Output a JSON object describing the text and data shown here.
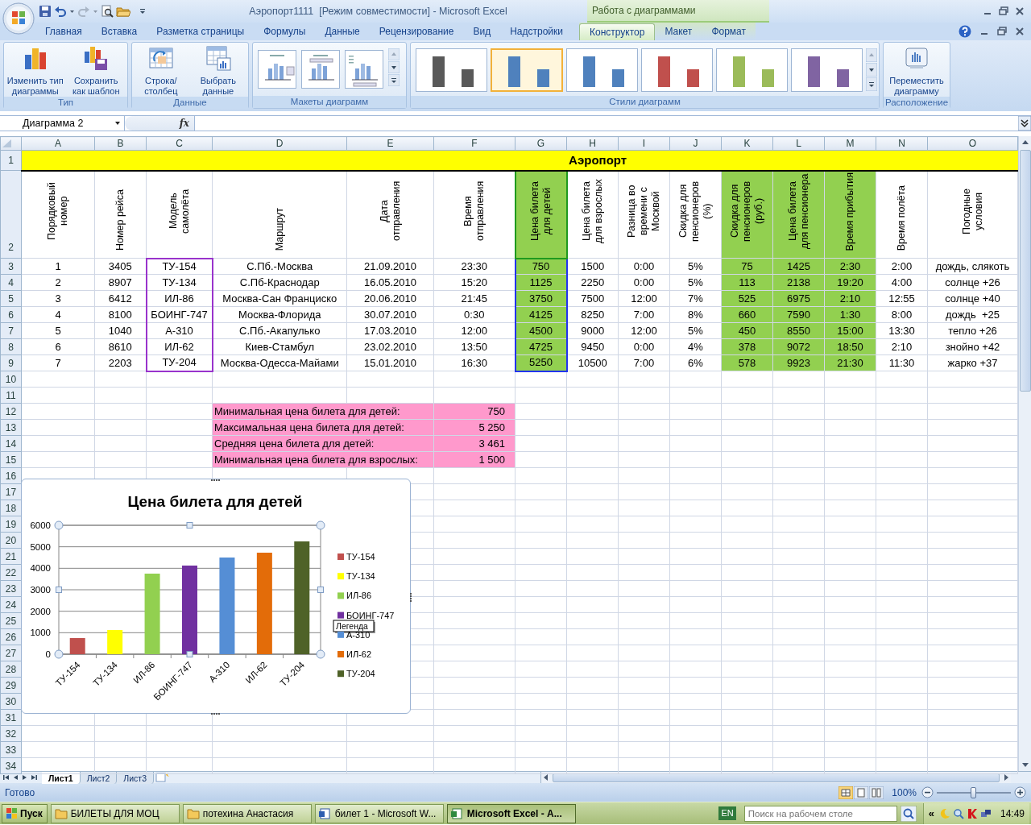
{
  "title_bar": {
    "title": "Аэропорт1111  [Режим совместимости] - Microsoft Excel",
    "context_group": "Работа с диаграммами"
  },
  "ribbon_tabs": [
    {
      "label": "Главная",
      "selected": false,
      "contextual": false
    },
    {
      "label": "Вставка",
      "selected": false,
      "contextual": false
    },
    {
      "label": "Разметка страницы",
      "selected": false,
      "contextual": false
    },
    {
      "label": "Формулы",
      "selected": false,
      "contextual": false
    },
    {
      "label": "Данные",
      "selected": false,
      "contextual": false
    },
    {
      "label": "Рецензирование",
      "selected": false,
      "contextual": false
    },
    {
      "label": "Вид",
      "selected": false,
      "contextual": false
    },
    {
      "label": "Надстройки",
      "selected": false,
      "contextual": false
    },
    {
      "label": "Конструктор",
      "selected": true,
      "contextual": true
    },
    {
      "label": "Макет",
      "selected": false,
      "contextual": true
    },
    {
      "label": "Формат",
      "selected": false,
      "contextual": true
    }
  ],
  "ribbon_groups": [
    {
      "label": "Тип",
      "kind": "buttons",
      "buttons": [
        {
          "label": "Изменить тип диаграммы",
          "kind": "change-type"
        },
        {
          "label": "Сохранить как шаблон",
          "kind": "save-template"
        }
      ]
    },
    {
      "label": "Данные",
      "kind": "buttons",
      "buttons": [
        {
          "label": "Строка/столбец",
          "kind": "switch"
        },
        {
          "label": "Выбрать данные",
          "kind": "select-data"
        }
      ]
    },
    {
      "label": "Макеты диаграмм",
      "kind": "layouts",
      "layouts": [
        {
          "kind": "legend-right"
        },
        {
          "kind": "legend-top"
        },
        {
          "kind": "legend-top-left"
        }
      ]
    },
    {
      "label": "Стили диаграмм",
      "kind": "styles",
      "styles": [
        {
          "color": "#595959",
          "selected": false
        },
        {
          "color": "#4f81bd",
          "selected": true
        },
        {
          "color": "#4f81bd",
          "selected": false
        },
        {
          "color": "#c0504d",
          "selected": false
        },
        {
          "color": "#9bbb59",
          "selected": false
        },
        {
          "color": "#8064a2",
          "selected": false
        }
      ]
    },
    {
      "label": "Расположение",
      "kind": "buttons",
      "buttons": [
        {
          "label": "Переместить диаграмму",
          "kind": "move"
        }
      ]
    }
  ],
  "formula_bar": {
    "name_box": "Диаграмма 2",
    "fx": "fx"
  },
  "sheet": {
    "title": "Аэропорт",
    "columns": [
      {
        "letter": "A",
        "heading": "Порядковый номер",
        "highlighted": false,
        "chart_categories": false,
        "chart_values": false
      },
      {
        "letter": "B",
        "heading": "Номер рейса",
        "highlighted": false,
        "chart_categories": false,
        "chart_values": false
      },
      {
        "letter": "C",
        "heading": "Модель самолёта",
        "highlighted": false,
        "chart_categories": true,
        "chart_values": false
      },
      {
        "letter": "D",
        "heading": "Маршрут",
        "highlighted": false,
        "chart_categories": false,
        "chart_values": false
      },
      {
        "letter": "E",
        "heading": "Дата отправления",
        "highlighted": false,
        "chart_categories": false,
        "chart_values": false
      },
      {
        "letter": "F",
        "heading": "Время отправления",
        "highlighted": false,
        "chart_categories": false,
        "chart_values": false
      },
      {
        "letter": "G",
        "heading": "Цена билета для детей",
        "highlighted": true,
        "chart_categories": false,
        "chart_values": true
      },
      {
        "letter": "H",
        "heading": "Цена билета для взрослых",
        "highlighted": false,
        "chart_categories": false,
        "chart_values": false
      },
      {
        "letter": "I",
        "heading": "Разница во времени с Москвой",
        "highlighted": false,
        "chart_categories": false,
        "chart_values": false
      },
      {
        "letter": "J",
        "heading": "Скидка для пенсионеров (%)",
        "highlighted": false,
        "chart_categories": false,
        "chart_values": false
      },
      {
        "letter": "K",
        "heading": "Скидка для пенсионеров (руб.)",
        "highlighted": true,
        "chart_categories": false,
        "chart_values": false
      },
      {
        "letter": "L",
        "heading": "Цена билета для пенсионера",
        "highlighted": true,
        "chart_categories": false,
        "chart_values": false
      },
      {
        "letter": "M",
        "heading": "Время прибытия",
        "highlighted": true,
        "chart_categories": false,
        "chart_values": false
      },
      {
        "letter": "N",
        "heading": "Время полёта",
        "highlighted": false,
        "chart_categories": false,
        "chart_values": false
      },
      {
        "letter": "O",
        "heading": "Погодные условия",
        "highlighted": false,
        "chart_categories": false,
        "chart_values": false
      }
    ],
    "row_numbers": [
      "1",
      "2",
      "3",
      "4",
      "5",
      "6",
      "7",
      "8",
      "9",
      "10",
      "11",
      "12",
      "13",
      "14",
      "15",
      "16",
      "17",
      "18",
      "19",
      "20",
      "21",
      "22",
      "23",
      "24",
      "25",
      "26",
      "27",
      "28",
      "29",
      "30",
      "31",
      "32",
      "33",
      "34"
    ],
    "rows": [
      [
        "1",
        "3405",
        "ТУ-154",
        "С.Пб.-Москва",
        "21.09.2010",
        "23:30",
        "750",
        "1500",
        "0:00",
        "5%",
        "75",
        "1425",
        "2:30",
        "2:00",
        "дождь, слякоть"
      ],
      [
        "2",
        "8907",
        "ТУ-134",
        "С.Пб-Краснодар",
        "16.05.2010",
        "15:20",
        "1125",
        "2250",
        "0:00",
        "5%",
        "113",
        "2138",
        "19:20",
        "4:00",
        "солнце +26"
      ],
      [
        "3",
        "6412",
        "ИЛ-86",
        "Москва-Сан Франциско",
        "20.06.2010",
        "21:45",
        "3750",
        "7500",
        "12:00",
        "7%",
        "525",
        "6975",
        "2:10",
        "12:55",
        "солнце +40"
      ],
      [
        "4",
        "8100",
        "БОИНГ-747",
        "Москва-Флорида",
        "30.07.2010",
        "0:30",
        "4125",
        "8250",
        "7:00",
        "8%",
        "660",
        "7590",
        "1:30",
        "8:00",
        "дождь  +25"
      ],
      [
        "5",
        "1040",
        "А-310",
        "С.Пб.-Акапулько",
        "17.03.2010",
        "12:00",
        "4500",
        "9000",
        "12:00",
        "5%",
        "450",
        "8550",
        "15:00",
        "13:30",
        "тепло +26"
      ],
      [
        "6",
        "8610",
        "ИЛ-62",
        "Киев-Стамбул",
        "23.02.2010",
        "13:50",
        "4725",
        "9450",
        "0:00",
        "4%",
        "378",
        "9072",
        "18:50",
        "2:10",
        "знойно +42"
      ],
      [
        "7",
        "2203",
        "ТУ-204",
        "Москва-Одесса-Майами",
        "15.01.2010",
        "16:30",
        "5250",
        "10500",
        "7:00",
        "6%",
        "578",
        "9923",
        "21:30",
        "11:30",
        "жарко +37"
      ]
    ],
    "summary": [
      {
        "label": "Минимальная цена билета для детей:",
        "value": "750"
      },
      {
        "label": "Максимальная цена билета для детей:",
        "value": "5 250"
      },
      {
        "label": "Средняя цена билета для детей:",
        "value": "3 461"
      },
      {
        "label": "Минимальная цена билета для взрослых:",
        "value": "1 500"
      }
    ]
  },
  "chart": {
    "chart_data": {
      "type": "bar",
      "title": "Цена билета для детей",
      "categories": [
        "ТУ-154",
        "ТУ-134",
        "ИЛ-86",
        "БОИНГ-747",
        "А-310",
        "ИЛ-62",
        "ТУ-204"
      ],
      "values": [
        750,
        1125,
        3750,
        4125,
        4500,
        4725,
        5250
      ],
      "ylim": [
        0,
        6000
      ],
      "grid": true,
      "yticks": [
        0,
        1000,
        2000,
        3000,
        4000,
        5000,
        6000
      ]
    },
    "legend": [
      {
        "label": "ТУ-154",
        "color": "#c0504d"
      },
      {
        "label": "ТУ-134",
        "color": "#ffff00"
      },
      {
        "label": "ИЛ-86",
        "color": "#92d050"
      },
      {
        "label": "БОИНГ-747",
        "color": "#7030a0"
      },
      {
        "label": "А-310",
        "color": "#558ed5"
      },
      {
        "label": "ИЛ-62",
        "color": "#e36c09"
      },
      {
        "label": "ТУ-204",
        "color": "#4f6228"
      }
    ],
    "tooltip": "Легенда"
  },
  "sheet_tabs": [
    {
      "label": "Лист1",
      "selected": true
    },
    {
      "label": "Лист2",
      "selected": false
    },
    {
      "label": "Лист3",
      "selected": false
    }
  ],
  "status_bar": {
    "status": "Готово",
    "zoom_label": "100%",
    "zoom_slider": {
      "level": 0.5
    }
  },
  "taskbar": {
    "start": "Пуск",
    "windows": [
      {
        "label": "БИЛЕТЫ ДЛЯ МОЦ",
        "kind": "folder",
        "selected": false
      },
      {
        "label": "потехина Анастасия",
        "kind": "folder",
        "selected": false
      },
      {
        "label": "билет 1 - Microsoft W...",
        "kind": "word",
        "selected": false
      },
      {
        "label": "Microsoft Excel - А...",
        "kind": "excel",
        "selected": true
      }
    ],
    "language": "EN",
    "search": {
      "placeholder": "Поиск на рабочем столе"
    },
    "chevron": "«",
    "clock": "14:49"
  }
}
